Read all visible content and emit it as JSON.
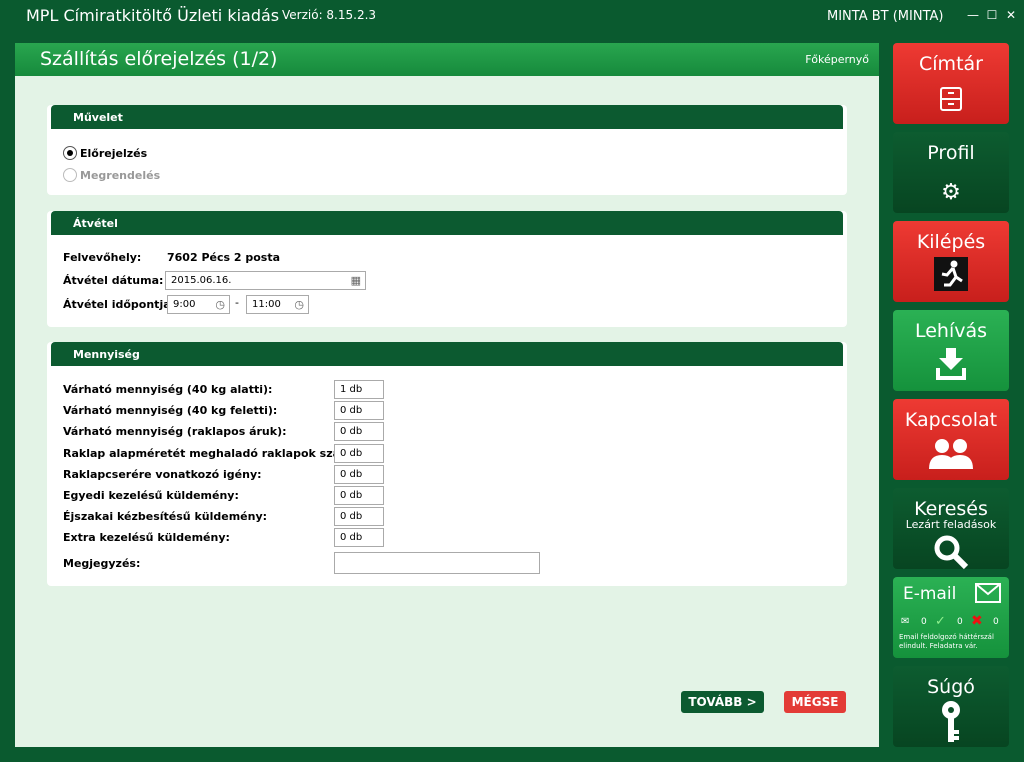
{
  "app": {
    "title": "MPL Címiratkitöltő Üzleti kiadás",
    "version": "Verzió: 8.15.2.3",
    "user": "MINTA BT (MINTA)",
    "minimize": "—",
    "maximize": "☐",
    "close": "✕"
  },
  "page": {
    "title": "Szállítás előrejelzés (1/2)",
    "home_link": "Főképernyő"
  },
  "muvelet": {
    "header": "Művelet",
    "options": [
      {
        "label": "Előrejelzés",
        "selected": true
      },
      {
        "label": "Megrendelés",
        "selected": false
      }
    ]
  },
  "atvetel": {
    "header": "Átvétel",
    "felvevohely_label": "Felvevőhely:",
    "felvevohely_value": "7602 Pécs 2 posta",
    "datum_label": "Átvétel dátuma:",
    "datum_value": "2015.06.16.",
    "idopont_label": "Átvétel időpontja:",
    "idopont_from": "9:00",
    "idopont_sep": "-",
    "idopont_to": "11:00"
  },
  "mennyiseg": {
    "header": "Mennyiség",
    "rows": [
      {
        "label": "Várható mennyiség (40 kg alatti):",
        "value": "1  db"
      },
      {
        "label": "Várható mennyiség (40 kg feletti):",
        "value": "0  db"
      },
      {
        "label": "Várható mennyiség (raklapos áruk):",
        "value": "0  db"
      },
      {
        "label": "Raklap alapméretét meghaladó raklapok száma:",
        "value": "0  db"
      },
      {
        "label": "Raklapcserére vonatkozó igény:",
        "value": "0  db"
      },
      {
        "label": "Egyedi kezelésű küldemény:",
        "value": "0  db"
      },
      {
        "label": "Éjszakai kézbesítésű küldemény:",
        "value": "0  db"
      },
      {
        "label": "Extra kezelésű küldemény:",
        "value": "0  db"
      }
    ],
    "note_label": "Megjegyzés:",
    "note_value": ""
  },
  "buttons": {
    "next": "TOVÁBB >",
    "cancel": "MÉGSE"
  },
  "sidebar": {
    "cimtar": "Címtár",
    "profil": "Profil",
    "kilepes": "Kilépés",
    "lehivas": "Lehívás",
    "kapcsolat": "Kapcsolat",
    "kereses": "Keresés",
    "kereses_sub": "Lezárt feladások",
    "email": "E-mail",
    "email_count_new": "0",
    "email_count_ok": "0",
    "email_count_err": "0",
    "email_status": "Email feldolgozó háttérszál elindult. Feladatra vár.",
    "sugo": "Súgó"
  },
  "colors": {
    "dark_green": "#0a5a2f",
    "header_green": "#29a64f",
    "panel_bg": "#e3f3e6",
    "red": "#e33b36"
  }
}
